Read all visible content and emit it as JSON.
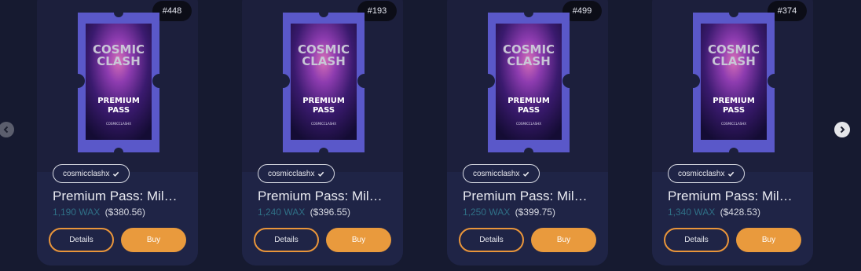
{
  "nav": {
    "prev_icon": "chevron-left-icon",
    "next_icon": "chevron-right-icon"
  },
  "cards": [
    {
      "badge": "#448",
      "collection": "cosmicclashx",
      "title": "Premium Pass: Mil…",
      "wax": "1,190 WAX",
      "usd": "($380.56)",
      "details_label": "Details",
      "buy_label": "Buy"
    },
    {
      "badge": "#193",
      "collection": "cosmicclashx",
      "title": "Premium Pass: Mil…",
      "wax": "1,240 WAX",
      "usd": "($396.55)",
      "details_label": "Details",
      "buy_label": "Buy"
    },
    {
      "badge": "#499",
      "collection": "cosmicclashx",
      "title": "Premium Pass: Mil…",
      "wax": "1,250 WAX",
      "usd": "($399.75)",
      "details_label": "Details",
      "buy_label": "Buy"
    },
    {
      "badge": "#374",
      "collection": "cosmicclashx",
      "title": "Premium Pass: Mil…",
      "wax": "1,340 WAX",
      "usd": "($428.53)",
      "details_label": "Details",
      "buy_label": "Buy"
    }
  ],
  "ticket_art": {
    "line1": "COSMIC",
    "line2": "CLASH",
    "line3": "PREMIUM",
    "line4": "PASS",
    "footer": "COSMICCLASHX"
  },
  "colors": {
    "background": "#161a30",
    "card": "#1d2142",
    "accent": "#e99a3d",
    "wax_price": "#2f6f86",
    "ticket_frame": "#5a58c9"
  }
}
